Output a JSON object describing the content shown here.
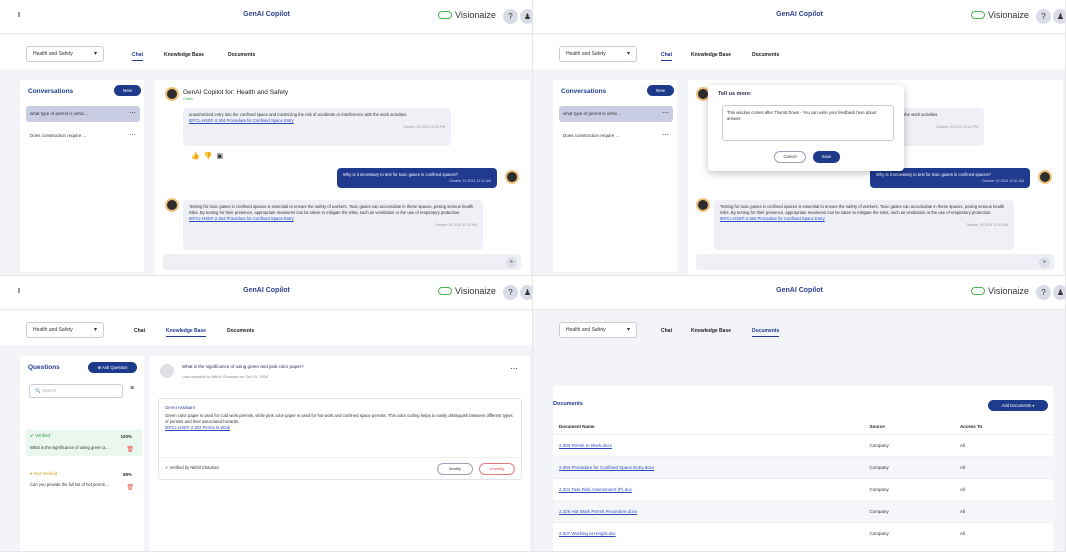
{
  "topbar": {
    "app_title": "GenAI Copilot",
    "brand": "Visionaize",
    "help_icon": "help-icon",
    "user_icon": "user-icon"
  },
  "common": {
    "selector_value": "Health and Safety",
    "tabs": [
      "Chat",
      "Knowledge Base",
      "Documents"
    ]
  },
  "chat": {
    "left_title": "Conversations",
    "new_button": "New",
    "conversations": [
      "what type of permit is vehic...",
      "Does construction require ..."
    ],
    "header_title": "GenAI Copilot for: Health and Safety",
    "status": "Online",
    "msg1_text": "unauthorized entry into the confined space and minimizing the risk of accidents or interference with the work activities.",
    "msg1_link": "IEFCL-HSEF-2.304 Procedure for Confined Space Entry",
    "msg1_time": "October 15 2024 10:43 PM",
    "user_msg": "Why is it necessary to test for toxic gases in confined spaces?",
    "user_time": "October 15 2024 12:31 AM",
    "msg2_text": "Testing for toxic gases in confined spaces is essential to ensure the safety of workers. Toxic gases can accumulate in these spaces, posing serious health risks. By testing for their presence, appropriate measures can be taken to mitigate the risks, such as ventilation or the use of respiratory protection.",
    "msg2_link": "IEFCL-HSEF-2.304 Procedure for Confined Space Entry",
    "msg2_time": "October 15 2024 12:31 AM"
  },
  "feedback_modal": {
    "title": "Tell us more:",
    "text": "This window comes after Thumb Down - You can write your feedback here about answer.",
    "cancel": "Cancel",
    "save": "Save"
  },
  "kb": {
    "left_title": "Questions",
    "ask_button": "Ask Question",
    "search_placeholder": "Search",
    "q1_status": "Verified",
    "q1_pct": "100%",
    "q1_text": "What is the significance of using green a...",
    "q2_status": "Not Verified",
    "q2_pct": "88%",
    "q2_text": "Can you provide the full list of hot permit...",
    "question": "What is the significance of using green and pink color paper?",
    "last_updated": "Last updated by Nikhil Chauhan on Oct 10, 2024",
    "assistant_label": "GenAI Assistant",
    "answer": "Green color paper is used for cold work permits, while pink color paper is used for hot work and confined space permits. This color coding helps to easily distinguish between different types of permits and their associated hazards.",
    "answer_link": "IEFCL-HSEF-2.303 Permit to Work",
    "verified_by": "Verified by Nikhil Chauhan",
    "modify": "Modify",
    "unverify": "Unverify"
  },
  "docs": {
    "title": "Documents",
    "add_button": "Add Documents",
    "columns": [
      "Document Name",
      "Source",
      "Access To"
    ],
    "rows": [
      [
        "2.303 Permit to Work.docx",
        "Company",
        "All"
      ],
      [
        "2.304 Procedure for Confined Space Entry.docx",
        "Company",
        "All"
      ],
      [
        "2.321 Task Risk Assessment (P).doc",
        "Company",
        "All"
      ],
      [
        "2.326 Hot Work Permit Procedure.docx",
        "Company",
        "All"
      ],
      [
        "2.327 Working at Height.doc",
        "Company",
        "All"
      ]
    ]
  },
  "colors": {
    "primary": "#1e3a8a",
    "brand_green": "#49b24d",
    "link": "#2b4bbf"
  }
}
